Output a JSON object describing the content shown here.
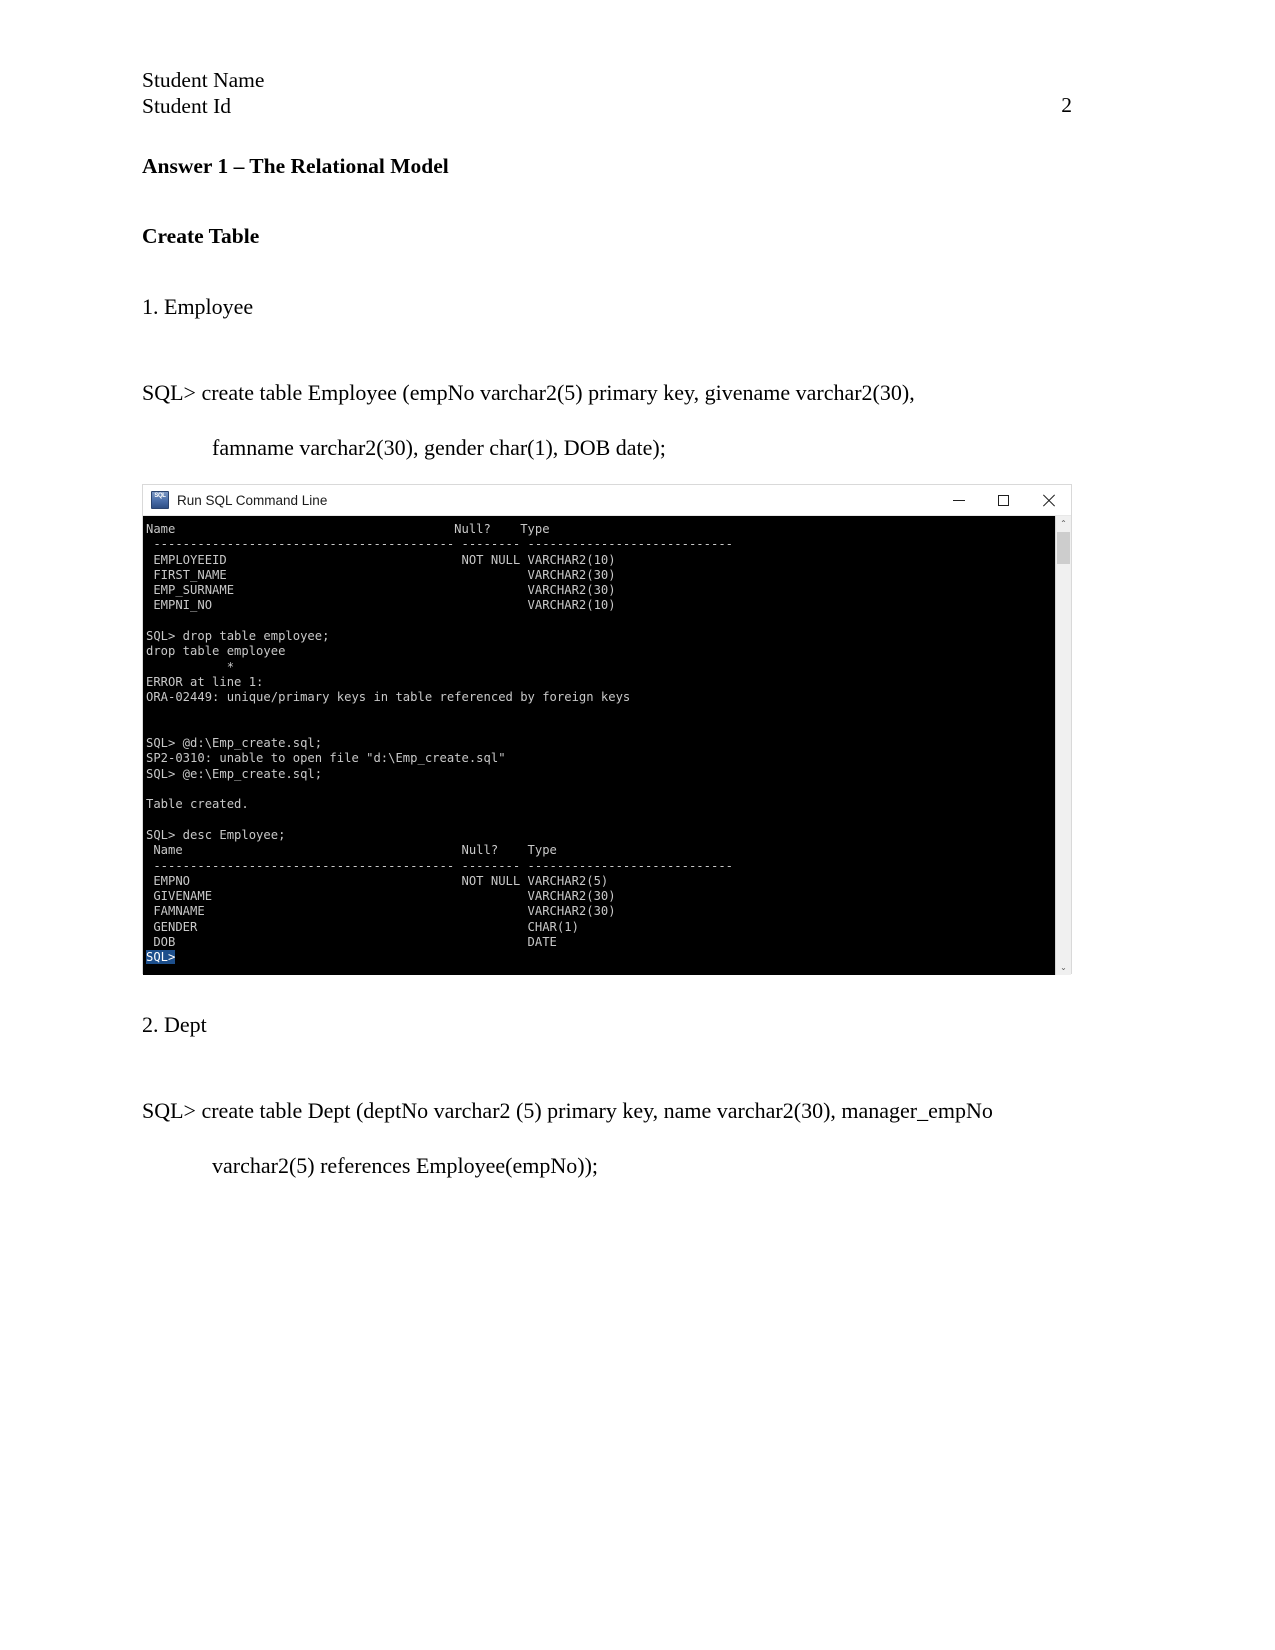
{
  "header": {
    "student_name": "Student Name",
    "student_id": "Student Id",
    "page_number": "2"
  },
  "headings": {
    "answer": "Answer 1 – The Relational Model",
    "create_table": "Create Table"
  },
  "sections": [
    {
      "number_label": "1. Employee",
      "sql_line1": "SQL>   create   table   Employee   (empNo   varchar2(5)   primary   key,   givename   varchar2(30),",
      "sql_line2": "famname varchar2(30), gender char(1), DOB date);"
    },
    {
      "number_label": "2. Dept",
      "sql_line1": "SQL> create table Dept (deptNo varchar2 (5) primary key, name varchar2(30), manager_empNo",
      "sql_line2": "varchar2(5) references Employee(empNo));"
    }
  ],
  "terminal_window": {
    "title": "Run SQL Command Line",
    "icon": "sql-app-icon",
    "buttons": {
      "minimize": "minimize-button",
      "maximize": "maximize-button",
      "close": "close-button"
    },
    "scrollbar": {
      "up_arrow": "⌃",
      "down_arrow": "⌄"
    },
    "output": "Name                                      Null?    Type\n ----------------------------------------- -------- ----------------------------\n EMPLOYEEID                                NOT NULL VARCHAR2(10)\n FIRST_NAME                                         VARCHAR2(30)\n EMP_SURNAME                                        VARCHAR2(30)\n EMPNI_NO                                           VARCHAR2(10)\n\nSQL> drop table employee;\ndrop table employee\n           *\nERROR at line 1:\nORA-02449: unique/primary keys in table referenced by foreign keys\n\n\nSQL> @d:\\Emp_create.sql;\nSP2-0310: unable to open file \"d:\\Emp_create.sql\"\nSQL> @e:\\Emp_create.sql;\n\nTable created.\n\nSQL> desc Employee;\n Name                                      Null?    Type\n ----------------------------------------- -------- ----------------------------\n EMPNO                                     NOT NULL VARCHAR2(5)\n GIVENAME                                           VARCHAR2(30)\n FAMNAME                                            VARCHAR2(30)\n GENDER                                             CHAR(1)\n DOB                                                DATE\n",
    "prompt": "SQL>"
  }
}
